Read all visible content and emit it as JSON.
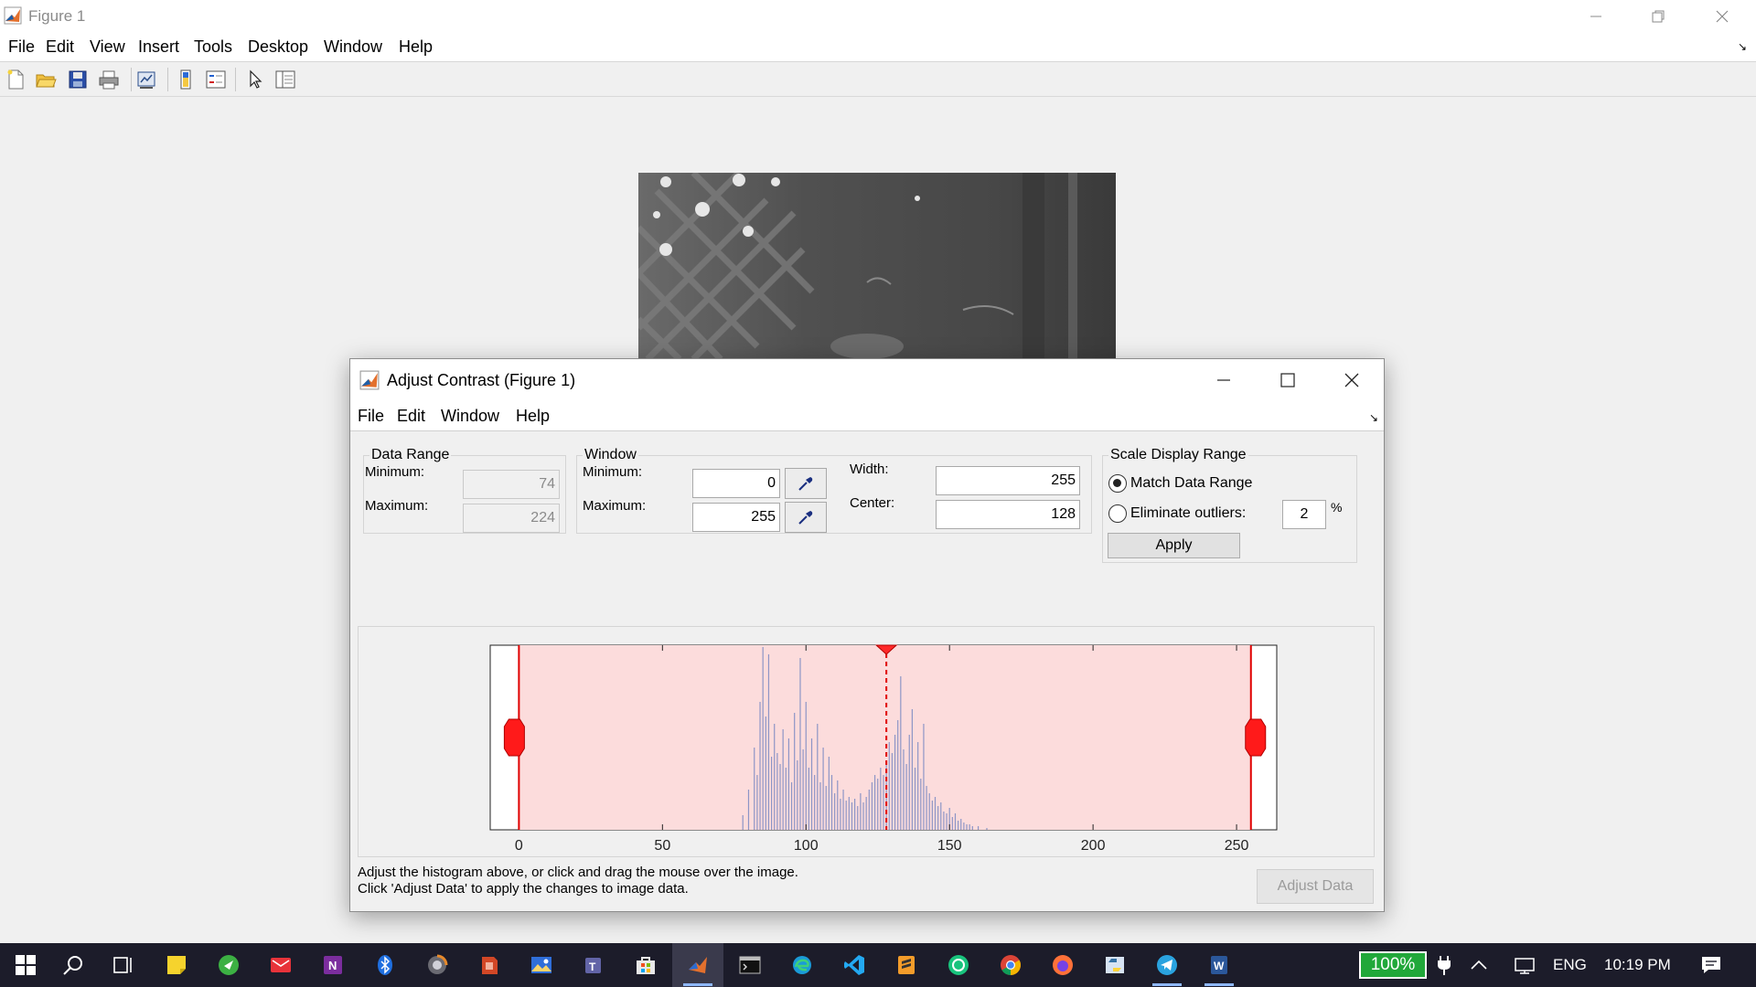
{
  "window": {
    "title": "Figure 1"
  },
  "menubar": {
    "items": [
      "File",
      "Edit",
      "View",
      "Insert",
      "Tools",
      "Desktop",
      "Window",
      "Help"
    ]
  },
  "toolbar": {
    "icons": [
      "new-figure-icon",
      "open-file-icon",
      "save-icon",
      "print-icon",
      "link-plot-icon",
      "colorbar-icon",
      "legend-icon",
      "pointer-icon",
      "property-inspector-icon"
    ]
  },
  "dialog": {
    "title": "Adjust Contrast (Figure 1)",
    "menus": [
      "File",
      "Edit",
      "Window",
      "Help"
    ],
    "data_range": {
      "legend": "Data Range",
      "min_label": "Minimum:",
      "min_value": "74",
      "max_label": "Maximum:",
      "max_value": "224"
    },
    "window_group": {
      "legend": "Window",
      "min_label": "Minimum:",
      "min_value": "0",
      "max_label": "Maximum:",
      "max_value": "255",
      "width_label": "Width:",
      "width_value": "255",
      "center_label": "Center:",
      "center_value": "128"
    },
    "scale": {
      "legend": "Scale Display Range",
      "match_label": "Match Data Range",
      "match_selected": true,
      "outliers_label": "Eliminate outliers:",
      "outliers_value": "2",
      "percent_sign": "%",
      "apply_label": "Apply"
    },
    "histogram": {
      "xlim": [
        -10,
        264
      ],
      "ticks": [
        0,
        50,
        100,
        150,
        200,
        250
      ],
      "window_min": 0,
      "window_max": 255,
      "window_center": 128,
      "bins": [
        [
          78,
          8
        ],
        [
          80,
          22
        ],
        [
          82,
          45
        ],
        [
          83,
          30
        ],
        [
          84,
          70
        ],
        [
          85,
          100
        ],
        [
          86,
          62
        ],
        [
          87,
          96
        ],
        [
          88,
          40
        ],
        [
          89,
          58
        ],
        [
          90,
          42
        ],
        [
          91,
          36
        ],
        [
          92,
          55
        ],
        [
          93,
          34
        ],
        [
          94,
          50
        ],
        [
          95,
          26
        ],
        [
          96,
          64
        ],
        [
          97,
          38
        ],
        [
          98,
          94
        ],
        [
          99,
          44
        ],
        [
          100,
          70
        ],
        [
          101,
          34
        ],
        [
          102,
          50
        ],
        [
          103,
          30
        ],
        [
          104,
          58
        ],
        [
          105,
          26
        ],
        [
          106,
          45
        ],
        [
          107,
          24
        ],
        [
          108,
          40
        ],
        [
          109,
          30
        ],
        [
          110,
          20
        ],
        [
          111,
          27
        ],
        [
          112,
          17
        ],
        [
          113,
          22
        ],
        [
          114,
          16
        ],
        [
          115,
          18
        ],
        [
          116,
          15
        ],
        [
          117,
          17
        ],
        [
          118,
          13
        ],
        [
          119,
          20
        ],
        [
          120,
          15
        ],
        [
          121,
          18
        ],
        [
          122,
          22
        ],
        [
          123,
          26
        ],
        [
          124,
          30
        ],
        [
          125,
          28
        ],
        [
          126,
          34
        ],
        [
          127,
          30
        ],
        [
          128,
          38
        ],
        [
          129,
          48
        ],
        [
          130,
          42
        ],
        [
          131,
          52
        ],
        [
          132,
          60
        ],
        [
          133,
          84
        ],
        [
          134,
          44
        ],
        [
          135,
          36
        ],
        [
          136,
          52
        ],
        [
          137,
          66
        ],
        [
          138,
          34
        ],
        [
          139,
          48
        ],
        [
          140,
          28
        ],
        [
          141,
          58
        ],
        [
          142,
          24
        ],
        [
          143,
          20
        ],
        [
          144,
          16
        ],
        [
          145,
          18
        ],
        [
          146,
          13
        ],
        [
          147,
          15
        ],
        [
          148,
          10
        ],
        [
          149,
          9
        ],
        [
          150,
          12
        ],
        [
          151,
          7
        ],
        [
          152,
          9
        ],
        [
          153,
          5
        ],
        [
          154,
          6
        ],
        [
          155,
          4
        ],
        [
          156,
          3
        ],
        [
          157,
          3
        ],
        [
          158,
          2
        ],
        [
          160,
          2
        ],
        [
          163,
          1
        ]
      ]
    },
    "instructions": [
      "Adjust the histogram above, or click and drag the mouse over the image.",
      "Click 'Adjust Data' to apply the changes to image data."
    ],
    "adjust_data_label": "Adjust Data"
  },
  "taskbar": {
    "apps": [
      "start-icon",
      "search-icon",
      "task-view-icon",
      "sticky-notes-icon",
      "greenshot-icon",
      "mail-icon",
      "onenote-icon",
      "bluetooth-icon",
      "browser-icon",
      "powerpoint-icon",
      "photos-icon",
      "teams-icon",
      "store-icon",
      "matlab-icon",
      "terminal-icon",
      "edge-icon",
      "vscode-icon",
      "sublime-icon",
      "chatgpt-icon",
      "chrome-icon",
      "firefox-icon",
      "python-icon",
      "telegram-icon",
      "word-icon"
    ],
    "battery": "100%",
    "language": "ENG",
    "time": "10:19 PM"
  }
}
